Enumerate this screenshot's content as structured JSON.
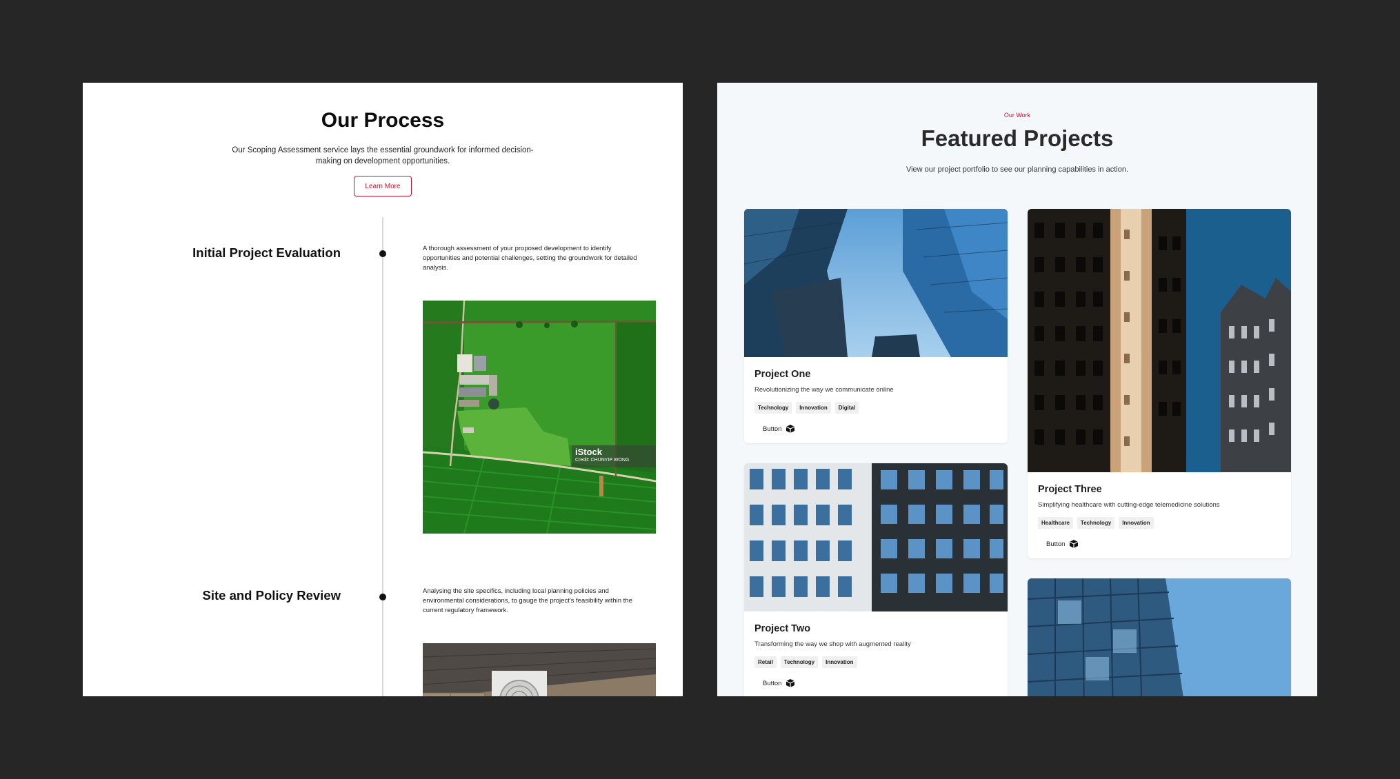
{
  "process": {
    "title": "Our Process",
    "subtitle": "Our Scoping Assessment service lays the essential groundwork for informed decision-making on development opportunities.",
    "cta_label": "Learn More",
    "steps": [
      {
        "title": "Initial Project Evaluation",
        "description": "A thorough assessment of your proposed development to identify opportunities and potential challenges, setting the groundwork for detailed analysis."
      },
      {
        "title": "Site and Policy Review",
        "description": "Analysing the site specifics, including local planning policies and environmental considerations, to gauge the project's feasibility within the current regulatory framework."
      }
    ],
    "image_watermark": {
      "brand": "iStock",
      "credit": "Credit: CHUNYIP WONG"
    }
  },
  "projects": {
    "label": "Our Work",
    "title": "Featured Projects",
    "subtitle": "View our project portfolio to see our planning capabilities in action.",
    "button_label": "Button",
    "cards": [
      {
        "title": "Project One",
        "description": "Revolutionizing the way we communicate online",
        "tags": [
          "Technology",
          "Innovation",
          "Digital"
        ]
      },
      {
        "title": "Project Two",
        "description": "Transforming the way we shop with augmented reality",
        "tags": [
          "Retail",
          "Technology",
          "Innovation"
        ]
      },
      {
        "title": "Project Three",
        "description": "Simplifying healthcare with cutting-edge telemedicine solutions",
        "tags": [
          "Healthcare",
          "Technology",
          "Innovation"
        ]
      }
    ]
  },
  "colors": {
    "background": "#262626",
    "accent": "#c8102e",
    "right_panel_bg": "#f5f8fb",
    "sky": "#6aa8dc"
  }
}
